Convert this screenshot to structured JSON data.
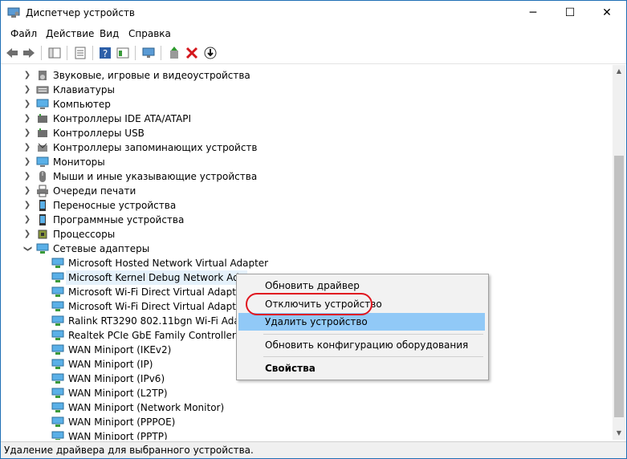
{
  "window": {
    "title": "Диспетчер устройств"
  },
  "titlebar_buttons": {
    "minimize": "─",
    "maximize": "☐",
    "close": "✕"
  },
  "menu": [
    "Файл",
    "Действие",
    "Вид",
    "Справка"
  ],
  "categories": [
    {
      "label": "Звуковые, игровые и видеоустройства",
      "icon": "speaker-icon"
    },
    {
      "label": "Клавиатуры",
      "icon": "keyboard-icon"
    },
    {
      "label": "Компьютер",
      "icon": "computer-icon"
    },
    {
      "label": "Контроллеры IDE ATA/ATAPI",
      "icon": "ide-controller-icon"
    },
    {
      "label": "Контроллеры USB",
      "icon": "usb-icon"
    },
    {
      "label": "Контроллеры запоминающих устройств",
      "icon": "storage-controller-icon"
    },
    {
      "label": "Мониторы",
      "icon": "monitor-icon"
    },
    {
      "label": "Мыши и иные указывающие устройства",
      "icon": "mouse-icon"
    },
    {
      "label": "Очереди печати",
      "icon": "printer-icon"
    },
    {
      "label": "Переносные устройства",
      "icon": "portable-device-icon"
    },
    {
      "label": "Программные устройства",
      "icon": "software-device-icon"
    },
    {
      "label": "Процессоры",
      "icon": "processor-icon"
    },
    {
      "label": "Сетевые адаптеры",
      "icon": "network-adapter-icon",
      "expanded": true
    }
  ],
  "adapters": [
    "Microsoft Hosted Network Virtual Adapter",
    "Microsoft Kernel Debug Network Adapter",
    "Microsoft Wi-Fi Direct Virtual Adapter",
    "Microsoft Wi-Fi Direct Virtual Adapter #2",
    "Ralink RT3290 802.11bgn Wi-Fi Adapter",
    "Realtek PCIe GbE Family Controller",
    "WAN Miniport (IKEv2)",
    "WAN Miniport (IP)",
    "WAN Miniport (IPv6)",
    "WAN Miniport (L2TP)",
    "WAN Miniport (Network Monitor)",
    "WAN Miniport (PPPOE)",
    "WAN Miniport (PPTP)"
  ],
  "selected_adapter_index": 1,
  "context_menu": {
    "update_driver": "Обновить драйвер",
    "disable_device": "Отключить устройство",
    "uninstall_device": "Удалить устройство",
    "scan_hardware": "Обновить конфигурацию оборудования",
    "properties": "Свойства"
  },
  "status_text": "Удаление драйвера для выбранного устройства.",
  "colors": {
    "highlight_ring": "#e0161f",
    "menu_hover": "#91c9f7",
    "selection": "#e5f1fb"
  }
}
